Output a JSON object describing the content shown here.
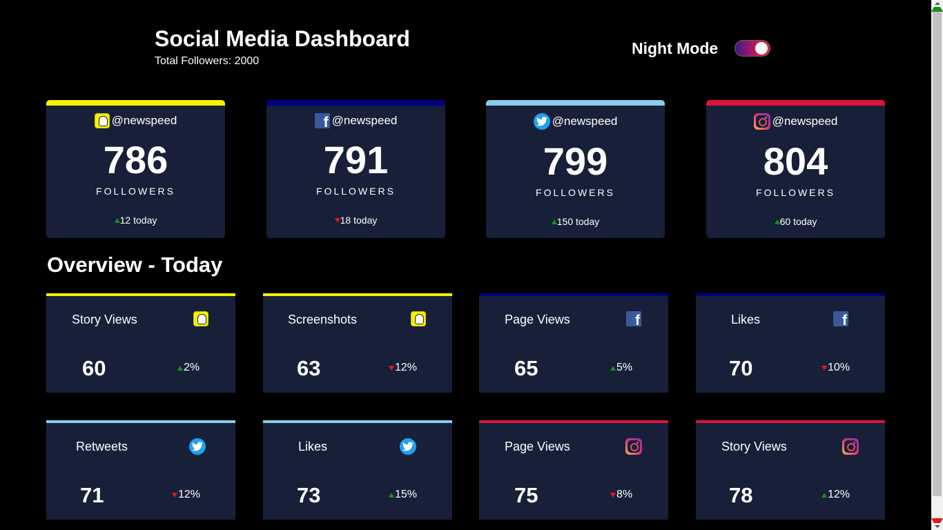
{
  "header": {
    "title": "Social Media Dashboard",
    "total_followers": "Total Followers: 2000",
    "night_mode_label": "Night Mode",
    "night_mode_on": true
  },
  "colors": {
    "snapchat": "#f7f300",
    "facebook": "#000080",
    "twitter": "#87ceeb",
    "instagram": "#dc143c",
    "card_bg": "#172038",
    "up": "#1f8a1f",
    "down": "#e3171e"
  },
  "followers": [
    {
      "network": "snapchat",
      "icon": "snapchat-icon",
      "handle": "@newspeed",
      "count": "786",
      "label": "FOLLOWERS",
      "trend": "up",
      "today": "12 today"
    },
    {
      "network": "facebook",
      "icon": "facebook-icon",
      "handle": "@newspeed",
      "count": "791",
      "label": "FOLLOWERS",
      "trend": "down",
      "today": "18 today"
    },
    {
      "network": "twitter",
      "icon": "twitter-icon",
      "handle": "@newspeed",
      "count": "799",
      "label": "FOLLOWERS",
      "trend": "up",
      "today": "150 today"
    },
    {
      "network": "instagram",
      "icon": "instagram-icon",
      "handle": "@newspeed",
      "count": "804",
      "label": "FOLLOWERS",
      "trend": "up",
      "today": "60 today"
    }
  ],
  "overview": {
    "title": "Overview - Today",
    "cards": [
      {
        "network": "snapchat",
        "title": "Story Views",
        "value": "60",
        "trend": "up",
        "pct": "2%"
      },
      {
        "network": "snapchat",
        "title": "Screenshots",
        "value": "63",
        "trend": "down",
        "pct": "12%"
      },
      {
        "network": "facebook",
        "title": "Page Views",
        "value": "65",
        "trend": "up",
        "pct": "5%"
      },
      {
        "network": "facebook",
        "title": "Likes",
        "value": "70",
        "trend": "down",
        "pct": "10%"
      },
      {
        "network": "twitter",
        "title": "Retweets",
        "value": "71",
        "trend": "down",
        "pct": "12%"
      },
      {
        "network": "twitter",
        "title": "Likes",
        "value": "73",
        "trend": "up",
        "pct": "15%"
      },
      {
        "network": "instagram",
        "title": "Page Views",
        "value": "75",
        "trend": "down",
        "pct": "8%"
      },
      {
        "network": "instagram",
        "title": "Story Views",
        "value": "78",
        "trend": "up",
        "pct": "12%"
      }
    ]
  }
}
